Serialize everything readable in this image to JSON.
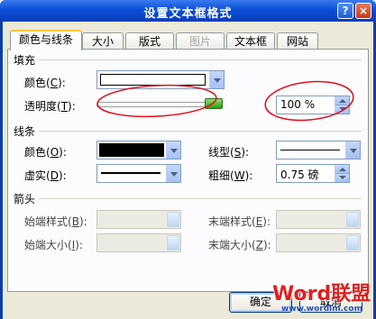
{
  "window": {
    "title": "设置文本框格式",
    "help": "?",
    "close": "×"
  },
  "tabs": [
    {
      "label": "颜色与线条",
      "active": true
    },
    {
      "label": "大小"
    },
    {
      "label": "版式"
    },
    {
      "label": "图片",
      "disabled": true
    },
    {
      "label": "文本框"
    },
    {
      "label": "网站"
    }
  ],
  "fill": {
    "section": "填充",
    "color_label": "颜色",
    "color_key": "C",
    "transparency_label": "透明度",
    "transparency_key": "T",
    "transparency_value": "100 %",
    "transparency_fraction": 1.0
  },
  "line": {
    "section": "线条",
    "color_label": "颜色",
    "color_key": "O",
    "color_value": "#000000",
    "style_label": "线型",
    "style_key": "S",
    "dash_label": "虚实",
    "dash_key": "D",
    "weight_label": "粗细",
    "weight_key": "W",
    "weight_value": "0.75 磅"
  },
  "arrows": {
    "section": "箭头",
    "begin_style_label": "始端样式",
    "begin_style_key": "B",
    "end_style_label": "末端样式",
    "end_style_key": "E",
    "begin_size_label": "始端大小",
    "begin_size_key": "I",
    "end_size_label": "末端大小",
    "end_size_key": "Z"
  },
  "buttons": {
    "ok": "确定",
    "cancel": "取消"
  },
  "watermark": {
    "brand": "Word联盟",
    "url": "www.wordlm.com"
  },
  "colors": {
    "annotation": "#e0101a",
    "title_bar": "#0b4fd8",
    "accent_tab": "#ffc83c"
  }
}
